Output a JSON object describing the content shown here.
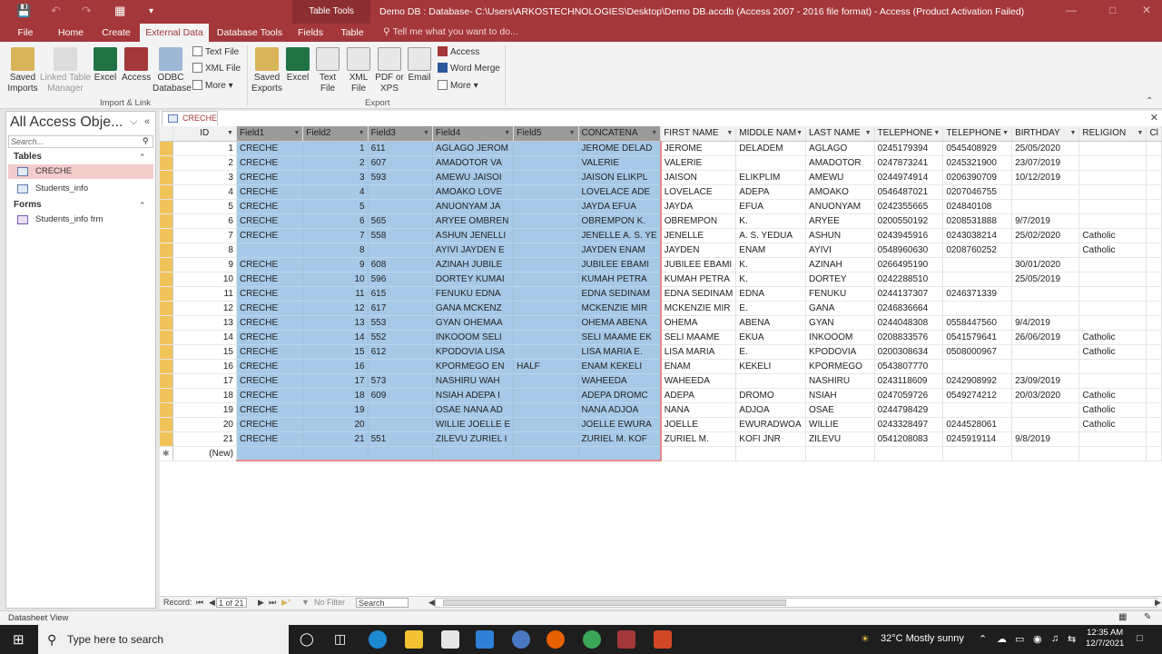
{
  "window": {
    "context_group": "Table Tools",
    "title": "Demo DB : Database- C:\\Users\\ARKOSTECHNOLOGIES\\Desktop\\Demo DB.accdb (Access 2007 - 2016 file format) - Access (Product Activation Failed)"
  },
  "tabs": [
    "File",
    "Home",
    "Create",
    "External Data",
    "Database Tools",
    "Fields",
    "Table"
  ],
  "tellme": "Tell me what you want to do...",
  "ribbon": {
    "import": {
      "saved_imports": "Saved Imports",
      "linked_table_manager": "Linked Table Manager",
      "excel": "Excel",
      "access": "Access",
      "odbc": "ODBC Database",
      "text_file": "Text File",
      "xml_file": "XML File",
      "more": "More",
      "group_label": "Import & Link"
    },
    "export": {
      "saved_exports": "Saved Exports",
      "excel": "Excel",
      "text_file": "Text File",
      "xml_file": "XML File",
      "pdf": "PDF or XPS",
      "email": "Email",
      "access": "Access",
      "word_merge": "Word Merge",
      "more": "More",
      "group_label": "Export"
    }
  },
  "nav": {
    "title": "All Access Obje...",
    "search_placeholder": "Search...",
    "tables_label": "Tables",
    "tables": [
      "CRECHE",
      "Students_info"
    ],
    "forms_label": "Forms",
    "forms": [
      "Students_info frm"
    ]
  },
  "document": {
    "tab": "CRECHE"
  },
  "grid": {
    "columns": [
      "ID",
      "Field1",
      "Field2",
      "Field3",
      "Field4",
      "Field5",
      "CONCATENA",
      "FIRST NAME",
      "MIDDLE NAM",
      "LAST NAME",
      "TELEPHONE",
      "TELEPHONE",
      "BIRTHDAY",
      "RELIGION",
      "Cl"
    ],
    "rows": [
      [
        "1",
        "CRECHE",
        "1",
        "611",
        "AGLAGO JEROM",
        "",
        "JEROME DELAD",
        "JEROME",
        "DELADEM",
        "AGLAGO",
        "0245179394",
        "0545408929",
        "25/05/2020",
        ""
      ],
      [
        "2",
        "CRECHE",
        "2",
        "607",
        "AMADOTOR VA",
        "",
        "VALERIE",
        "VALERIE",
        "",
        "AMADOTOR",
        "0247873241",
        "0245321900",
        "23/07/2019",
        ""
      ],
      [
        "3",
        "CRECHE",
        "3",
        "593",
        "AMEWU JAISOI",
        "",
        "JAISON ELIKPL",
        "JAISON",
        "ELIKPLIM",
        "AMEWU",
        "0244974914",
        "0206390709",
        "10/12/2019",
        ""
      ],
      [
        "4",
        "CRECHE",
        "4",
        "",
        "AMOAKO LOVE",
        "",
        "LOVELACE ADE",
        "LOVELACE",
        "ADEPA",
        "AMOAKO",
        "0546487021",
        "0207046755",
        "",
        ""
      ],
      [
        "5",
        "CRECHE",
        "5",
        "",
        "ANUONYAM JA",
        "",
        "JAYDA EFUA",
        "JAYDA",
        "EFUA",
        "ANUONYAM",
        "0242355665",
        "024840108",
        "",
        ""
      ],
      [
        "6",
        "CRECHE",
        "6",
        "565",
        "ARYEE OMBREN",
        "",
        "OBREMPON K.",
        "OBREMPON",
        "K.",
        "ARYEE",
        "0200550192",
        "0208531888",
        "9/7/2019",
        ""
      ],
      [
        "7",
        "CRECHE",
        "7",
        "558",
        "ASHUN JENELLI",
        "",
        "JENELLE A. S. YE",
        "JENELLE",
        "A. S. YEDUA",
        "ASHUN",
        "0243945916",
        "0243038214",
        "25/02/2020",
        "Catholic"
      ],
      [
        "8",
        "",
        "8",
        "",
        "AYIVI JAYDEN E",
        "",
        "JAYDEN ENAM",
        "JAYDEN",
        "ENAM",
        "AYIVI",
        "0548960630",
        "0208760252",
        "",
        "Catholic"
      ],
      [
        "9",
        "CRECHE",
        "9",
        "608",
        "AZINAH JUBILE",
        "",
        "JUBILEE EBAMI",
        "JUBILEE EBAMI",
        "K.",
        "AZINAH",
        "0266495190",
        "",
        "30/01/2020",
        ""
      ],
      [
        "10",
        "CRECHE",
        "10",
        "596",
        "DORTEY KUMAI",
        "",
        "KUMAH PETRA",
        "KUMAH PETRA",
        "K.",
        "DORTEY",
        "0242288510",
        "",
        "25/05/2019",
        ""
      ],
      [
        "11",
        "CRECHE",
        "11",
        "615",
        "FENUKU EDNA",
        "",
        "EDNA SEDINAM",
        "EDNA SEDINAM",
        "EDNA",
        "FENUKU",
        "0244137307",
        "0246371339",
        "",
        ""
      ],
      [
        "12",
        "CRECHE",
        "12",
        "617",
        "GANA MCKENZ",
        "",
        "MCKENZIE MIR",
        "MCKENZIE MIR",
        "E.",
        "GANA",
        "0246836664",
        "",
        "",
        ""
      ],
      [
        "13",
        "CRECHE",
        "13",
        "553",
        "GYAN OHEMAA",
        "",
        "OHEMA ABENA",
        "OHEMA",
        "ABENA",
        "GYAN",
        "0244048308",
        "0558447560",
        "9/4/2019",
        ""
      ],
      [
        "14",
        "CRECHE",
        "14",
        "552",
        "INKOOOM SELI",
        "",
        "SELI MAAME EK",
        "SELI MAAME",
        "EKUA",
        "INKOOOM",
        "0208833576",
        "0541579641",
        "26/06/2019",
        "Catholic"
      ],
      [
        "15",
        "CRECHE",
        "15",
        "612",
        "KPODOVIA LISA",
        "",
        "LISA MARIA E.",
        "LISA MARIA",
        "E.",
        "KPODOVIA",
        "0200308634",
        "0508000967",
        "",
        "Catholic"
      ],
      [
        "16",
        "CRECHE",
        "16",
        "",
        "KPORMEGO EN",
        "HALF",
        "ENAM KEKELI",
        "ENAM",
        "KEKELI",
        "KPORMEGO",
        "0543807770",
        "",
        "",
        ""
      ],
      [
        "17",
        "CRECHE",
        "17",
        "573",
        "NASHIRU WAH",
        "",
        "WAHEEDA",
        "WAHEEDA",
        "",
        "NASHIRU",
        "0243118609",
        "0242908992",
        "23/09/2019",
        ""
      ],
      [
        "18",
        "CRECHE",
        "18",
        "609",
        "NSIAH ADEPA I",
        "",
        "ADEPA DROMC",
        "ADEPA",
        "DROMO",
        "NSIAH",
        "0247059726",
        "0549274212",
        "20/03/2020",
        "Catholic"
      ],
      [
        "19",
        "CRECHE",
        "19",
        "",
        "OSAE NANA AD",
        "",
        "NANA ADJOA",
        "NANA",
        "ADJOA",
        "OSAE",
        "0244798429",
        "",
        "",
        "Catholic"
      ],
      [
        "20",
        "CRECHE",
        "20",
        "",
        "WILLIE JOELLE E",
        "",
        "JOELLE EWURA",
        "JOELLE",
        "EWURADWOA",
        "WILLIE",
        "0243328497",
        "0244528061",
        "",
        "Catholic"
      ],
      [
        "21",
        "CRECHE",
        "21",
        "551",
        "ZILEVU ZURIEL I",
        "",
        "ZURIEL M.  KOF",
        "ZURIEL M.",
        "KOFI JNR",
        "ZILEVU",
        "0541208083",
        "0245919114",
        "9/8/2019",
        ""
      ]
    ],
    "new_row_label": "(New)"
  },
  "record_nav": {
    "label": "Record:",
    "position": "1 of 21",
    "filter": "No Filter",
    "search": "Search"
  },
  "status": {
    "view": "Datasheet View"
  },
  "taskbar": {
    "search_placeholder": "Type here to search",
    "weather": "32°C  Mostly sunny",
    "time": "12:35 AM",
    "date": "12/7/2021"
  },
  "colors": {
    "access_red": "#a4373a",
    "selection_blue": "#a6c9e8",
    "row_selector": "#f0c35a"
  }
}
